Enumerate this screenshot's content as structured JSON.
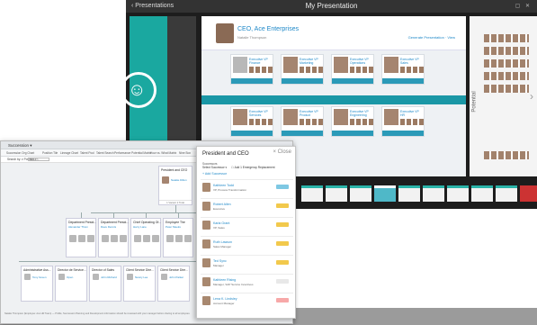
{
  "presentation": {
    "back_label": "Presentations",
    "title": "My Presentation",
    "ceo_name": "CEO, Ace Enterprises",
    "ceo_role": "Natalie Thompson",
    "ceo_right_text": "Generate Presentation · View",
    "side_label": "Potential",
    "chevron": "›"
  },
  "slide_cards": [
    {
      "name": "Executive VP Finance"
    },
    {
      "name": "Executive VP Marketing"
    },
    {
      "name": "Executive VP Operations"
    },
    {
      "name": "Executive VP Sales"
    },
    {
      "name": "Executive VP Services"
    },
    {
      "name": "Executive VP Product"
    },
    {
      "name": "Executive VP Engineering"
    },
    {
      "name": "Executive VP HR"
    }
  ],
  "org": {
    "brand": "Succession ▾",
    "tabs": [
      "Succession Org Chart",
      "Position Tile",
      "Lineage Chart",
      "Talent Pool",
      "Talent Search",
      "Performance Potential Matrix",
      "How vs. What Matrix",
      "Nine Box"
    ],
    "search_label": "Search by:  ▾ Position  ▾",
    "search_placeholder": "Search",
    "top_node": {
      "title": "President and CEO",
      "sub": "Natalie Dillon",
      "foot": "1 Vacant  2 Total"
    },
    "mid_nodes": [
      {
        "title": "Department Presid...",
        "sub": "Alexander Thom"
      },
      {
        "title": "Department Presid...",
        "sub": "Dave Dennis"
      },
      {
        "title": "Chief Operating Of...",
        "sub": "Harry Lane"
      },
      {
        "title": "Employee The",
        "sub": "Peter Meeks"
      }
    ],
    "bottom_nodes": [
      {
        "title": "Administrative Ass...",
        "sub": "Tony Green"
      },
      {
        "title": "Director de Service...",
        "sub": "Open"
      },
      {
        "title": "Director of Sales",
        "sub": "John Richard"
      },
      {
        "title": "Client Service Dire...",
        "sub": "Nancy Lee"
      },
      {
        "title": "Client Service Dire...",
        "sub": "John Parker"
      }
    ],
    "footer": "Natalie Thompson (Employee: Ace HR Team) — Profile, Succession Planning and Development information should be reviewed with your manager before sharing to all employees."
  },
  "panel": {
    "title": "President and CEO",
    "close": "× Close",
    "succ_label": "Successors",
    "select_label": "Select Successor  ▾",
    "checkbox_label": "☐ Add 1 Emergency Replacement",
    "add_label": "+ Add Successor",
    "rows": [
      {
        "name": "Kathleen Todd",
        "title": "VP, Process Transformation",
        "color": "#7ec8e3"
      },
      {
        "name": "Robert Allen",
        "title": "Executive",
        "color": "#f2c94c"
      },
      {
        "name": "Karla Grant",
        "title": "VP, Sales",
        "color": "#f2c94c"
      },
      {
        "name": "Ruth Lawson",
        "title": "Sales Manager",
        "color": "#f2c94c"
      },
      {
        "name": "Ted Sync",
        "title": "Manager",
        "color": "#f2c94c"
      },
      {
        "name": "Kathleen Rising",
        "title": "Manager, SAP Service Incentives",
        "color": "#e8e8e8"
      },
      {
        "name": "Lena K. Lindsley",
        "title": "Account Manager",
        "color": "#f7a8a8"
      }
    ]
  },
  "colors": {
    "accent": "#1aa8a0",
    "link": "#1e88c8",
    "pres_bg": "#1d1d1d"
  }
}
